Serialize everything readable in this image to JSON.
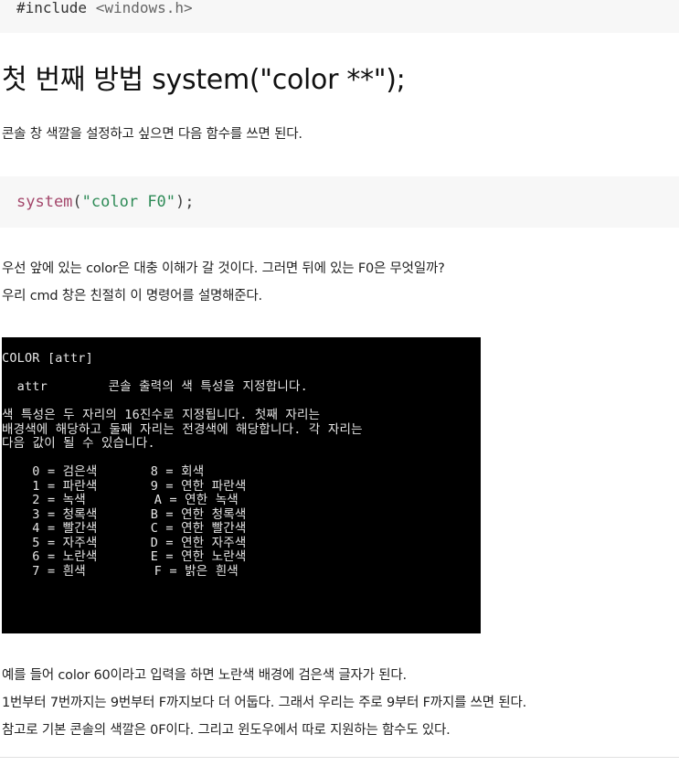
{
  "code_include": {
    "prefix": "#include ",
    "lib": "<windows.h>"
  },
  "heading": "첫 번째 방법 system(\"color **\");",
  "intro": "콘솔 창 색깔을 설정하고 싶으면 다음 함수를 쓰면 된다.",
  "code_example": {
    "func": "system",
    "open": "(",
    "arg": "\"color F0\"",
    "close": ");"
  },
  "para1": "우선 앞에 있는 color은 대충 이해가 갈 것이다. 그러면 뒤에 있는 F0은 무엇일까?",
  "para2": "우리 cmd 창은 친절히 이 명령어를 설명해준다.",
  "console_lines": [
    "COLOR [attr]",
    "",
    "  attr        콘솔 출력의 색 특성을 지정합니다.",
    "",
    "색 특성은 두 자리의 16진수로 지정됩니다. 첫째 자리는",
    "배경색에 해당하고 둘째 자리는 전경색에 해당합니다. 각 자리는",
    "다음 값이 될 수 있습니다.",
    "",
    "    0 = 검은색       8 = 회색",
    "    1 = 파란색       9 = 연한 파란색",
    "    2 = 녹색         A = 연한 녹색",
    "    3 = 청록색       B = 연한 청록색",
    "    4 = 빨간색       C = 연한 빨간색",
    "    5 = 자주색       D = 연한 자주색",
    "    6 = 노란색       E = 연한 노란색",
    "    7 = 흰색         F = 밝은 흰색"
  ],
  "para3": "예를 들어 color 60이라고 입력을 하면 노란색 배경에 검은색 글자가 된다.",
  "para4": "1번부터 7번까지는 9번부터 F까지보다 더 어둡다.  그래서 우리는 주로 9부터 F까지를 쓰면 된다.",
  "para5": "참고로 기본 콘솔의 색깔은 0F이다. 그리고 윈도우에서 따로 지원하는 함수도 있다."
}
